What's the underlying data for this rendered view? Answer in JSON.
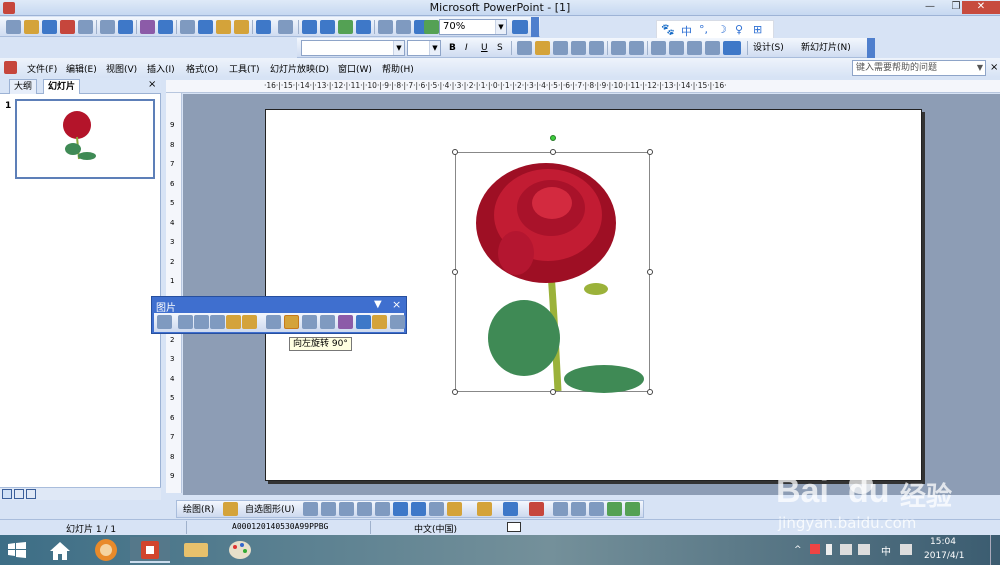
{
  "window": {
    "title": "Microsoft PowerPoint - [1]",
    "minimize": "—",
    "restore": "❐",
    "close": "✕"
  },
  "toolbar": {
    "zoom_value": "70%",
    "font_name": "",
    "font_size": "",
    "bold": "B",
    "italic": "I",
    "underline": "U",
    "shadow": "S",
    "design_label": "设计(S)",
    "new_slide_label": "新幻灯片(N)"
  },
  "ime": {
    "items": [
      "中",
      "°,",
      "☽",
      "♀",
      "⊞"
    ]
  },
  "menu": {
    "items": [
      "文件(F)",
      "编辑(E)",
      "视图(V)",
      "插入(I)",
      "格式(O)",
      "工具(T)",
      "幻灯片放映(D)",
      "窗口(W)",
      "帮助(H)"
    ],
    "help_placeholder": "键入需要帮助的问题"
  },
  "outline_pane": {
    "tabs": [
      "大纲",
      "幻灯片"
    ],
    "close": "×",
    "slide_number": "1"
  },
  "ruler": {
    "horizontal": "·16·|·15·|·14·|·13·|·12·|·11·|·10·|·9·|·8·|·7·|·6·|·5·|·4·|·3·|·2·|·1·|·0·|·1·|·2·|·3·|·4·|·5·|·6·|·7·|·8·|·9·|·10·|·11·|·12·|·13·|·14·|·15·|·16·",
    "vertical": [
      "9",
      "8",
      "7",
      "6",
      "5",
      "4",
      "3",
      "2",
      "1",
      "0",
      "1",
      "2",
      "3",
      "4",
      "5",
      "6",
      "7",
      "8",
      "9"
    ]
  },
  "picture_toolbar": {
    "title": "图片",
    "close": "×",
    "tooltip": "向左旋转 90°"
  },
  "draw_toolbar": {
    "draw_label": "绘图(R)",
    "autoshapes_label": "自选图形(U)"
  },
  "statusbar": {
    "slide_info": "幻灯片 1 / 1",
    "design_name": "A000120140530A99PPBG",
    "language": "中文(中国)"
  },
  "taskbar": {
    "time": "15:04",
    "date": "2017/4/1",
    "ime_indicator": "中"
  },
  "watermark": {
    "brand": "Bai",
    "brand2": "du",
    "jingyan": "经验",
    "url": "jingyan.baidu.com"
  },
  "colors": {
    "accent_blue": "#3f6fcf",
    "rose_red": "#b4142a",
    "leaf_green": "#3f8a55",
    "workspace": "#8d9db5"
  }
}
